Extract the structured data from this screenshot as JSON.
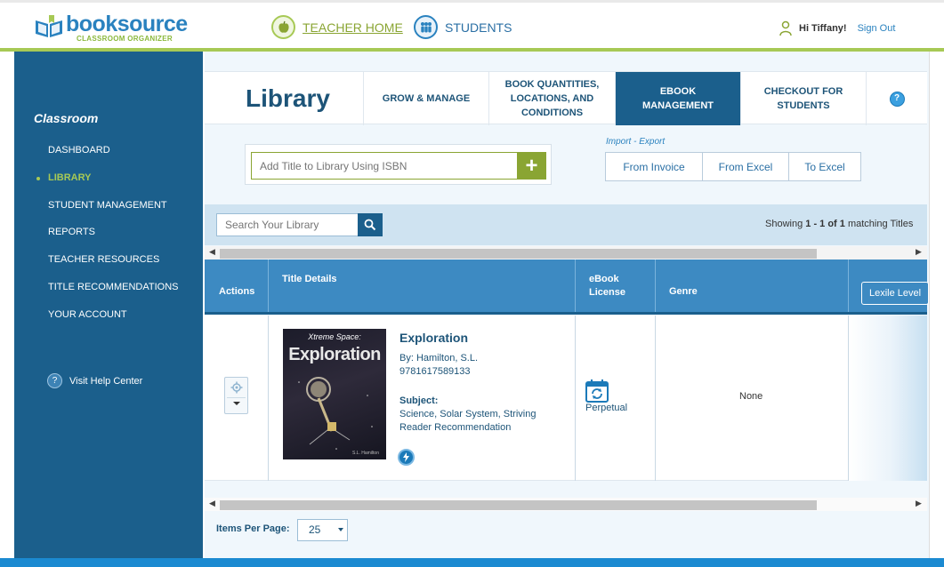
{
  "brand": {
    "name": "booksource",
    "tagline": "CLASSROOM ORGANIZER"
  },
  "topnav": {
    "teacher_home": "TEACHER HOME",
    "students": "STUDENTS",
    "greeting": "Hi Tiffany!",
    "sign_out": "Sign Out"
  },
  "sidebar": {
    "section_title": "Classroom",
    "items": [
      {
        "label": "DASHBOARD",
        "active": false
      },
      {
        "label": "LIBRARY",
        "active": true
      },
      {
        "label": "STUDENT MANAGEMENT",
        "active": false
      },
      {
        "label": "REPORTS",
        "active": false
      },
      {
        "label": "TEACHER RESOURCES",
        "active": false
      },
      {
        "label": "TITLE RECOMMENDATIONS",
        "active": false
      },
      {
        "label": "YOUR ACCOUNT",
        "active": false
      }
    ],
    "help": "Visit Help Center"
  },
  "header": {
    "title": "Library",
    "tabs": [
      {
        "label": "GROW & MANAGE",
        "active": false
      },
      {
        "label": "BOOK QUANTITIES, LOCATIONS, AND CONDITIONS",
        "active": false
      },
      {
        "label": "eBOOK MANAGEMENT",
        "active": true
      },
      {
        "label": "CHECKOUT FOR STUDENTS",
        "active": false
      }
    ],
    "help_icon": "?"
  },
  "isbn": {
    "placeholder": "Add Title to Library Using ISBN",
    "add_icon": "+"
  },
  "import_export": {
    "label": "Import - Export",
    "buttons": [
      "From Invoice",
      "From Excel",
      "To Excel"
    ]
  },
  "search": {
    "placeholder": "Search Your Library"
  },
  "showing": {
    "prefix": "Showing",
    "range": "1 - 1 of 1",
    "suffix": "matching Titles"
  },
  "table": {
    "headers": {
      "actions": "Actions",
      "title_details": "Title Details",
      "ebook_license": "eBook License",
      "genre": "Genre",
      "lexile": "Lexile Level"
    },
    "rows": [
      {
        "cover_series": "Xtreme Space:",
        "cover_title": "Exploration",
        "cover_author": "S.L. Hamilton",
        "title": "Exploration",
        "author": "By: Hamilton, S.L.",
        "isbn": "9781617589133",
        "subject_label": "Subject:",
        "subjects": "Science, Solar System, Striving Reader Recommendation",
        "license": "Perpetual",
        "genre": "None"
      }
    ]
  },
  "pagination": {
    "label": "Items Per Page:",
    "value": "25"
  },
  "colors": {
    "primary": "#1b5f8c",
    "accent_green": "#a7c955",
    "table_header": "#3d8ac2",
    "link": "#2a82bf"
  }
}
